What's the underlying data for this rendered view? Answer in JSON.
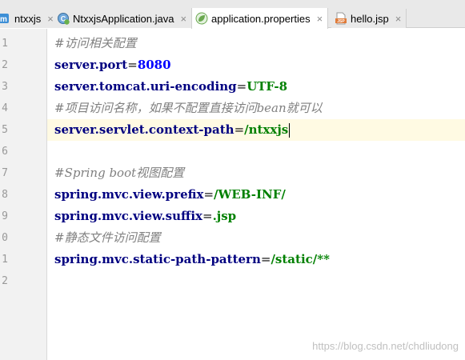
{
  "tabs": [
    {
      "label": "ntxxjs",
      "icon": "module-icon",
      "active": false
    },
    {
      "label": "NtxxjsApplication.java",
      "icon": "spring-boot-class-icon",
      "active": false
    },
    {
      "label": "application.properties",
      "icon": "spring-leaf-icon",
      "active": true
    },
    {
      "label": "hello.jsp",
      "icon": "jsp-file-icon",
      "active": false
    }
  ],
  "tab_close_glyph": "×",
  "gutter": {
    "line_numbers": [
      "1",
      "2",
      "3",
      "4",
      "5",
      "6",
      "7",
      "8",
      "9",
      "0",
      "1",
      "2"
    ]
  },
  "editor": {
    "current_line": 5,
    "lines": [
      {
        "type": "comment",
        "text": "#访问相关配置"
      },
      {
        "type": "prop",
        "key": "server.port",
        "eq": "=",
        "value": "8080",
        "value_kind": "number"
      },
      {
        "type": "prop",
        "key": "server.tomcat.uri-encoding",
        "eq": "=",
        "value": "UTF-8",
        "value_kind": "string"
      },
      {
        "type": "comment",
        "text": "#项目访问名称，如果不配置直接访问bean就可以"
      },
      {
        "type": "prop",
        "key": "server.servlet.context-path",
        "eq": "=",
        "value": "/ntxxjs",
        "value_kind": "string"
      },
      {
        "type": "blank"
      },
      {
        "type": "comment",
        "text": "#Spring boot视图配置"
      },
      {
        "type": "prop",
        "key": "spring.mvc.view.prefix",
        "eq": "=",
        "value": "/WEB-INF/",
        "value_kind": "string"
      },
      {
        "type": "prop",
        "key": "spring.mvc.view.suffix",
        "eq": "=",
        "value": ".jsp",
        "value_kind": "string"
      },
      {
        "type": "comment",
        "text": "#静态文件访问配置"
      },
      {
        "type": "prop",
        "key": "spring.mvc.static-path-pattern",
        "eq": "=",
        "value": "/static/**",
        "value_kind": "string"
      },
      {
        "type": "blank"
      }
    ]
  },
  "watermark": "https://blog.csdn.net/chdliudong",
  "colors": {
    "comment": "#808080",
    "key": "#000080",
    "value": "#008000",
    "number": "#0000ff",
    "current_line_bg": "#fffae3",
    "tab_bar_bg": "#e9e9e9",
    "gutter_bg": "#f2f2f2"
  }
}
